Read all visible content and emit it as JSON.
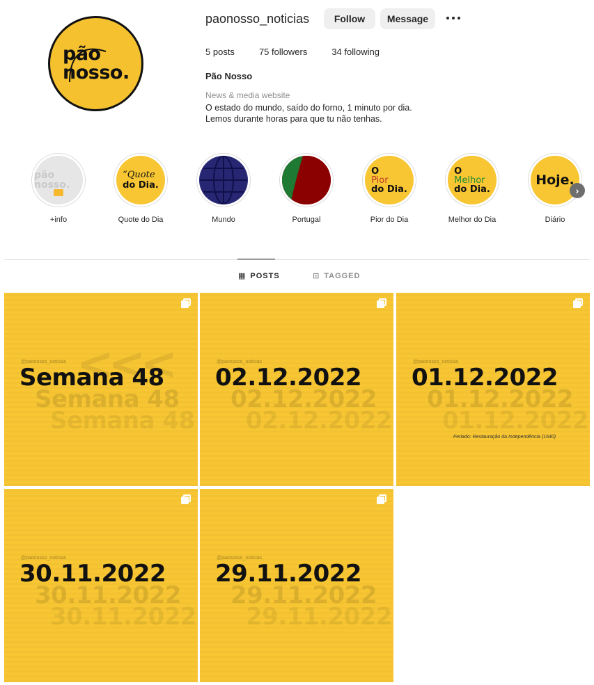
{
  "profile": {
    "username": "paonosso_noticias",
    "follow_label": "Follow",
    "message_label": "Message",
    "more_icon": "more-horizontal-icon",
    "avatar_text_line1": "pão",
    "avatar_text_line2": "nosso.",
    "posts": "5",
    "posts_label": "posts",
    "followers": "75",
    "followers_label": "followers",
    "following": "34",
    "following_label": "following",
    "full_name": "Pão Nosso",
    "category": "News & media website",
    "bio_line1": "O estado do mundo, saído do forno, 1 minuto por dia.",
    "bio_line2": "Lemos durante horas para que tu não tenhas."
  },
  "highlights": [
    {
      "label": "+info",
      "cover_text": "pão nosso.",
      "bg": "#e8e8e8"
    },
    {
      "label": "Quote do Dia",
      "cover_text_1": "“Quote",
      "cover_text_2": "do Dia.",
      "bg": "#f8c633"
    },
    {
      "label": "Mundo",
      "bg": "#2a2a7a"
    },
    {
      "label": "Portugal",
      "bg": "#8b0000",
      "accent": "#1e7a33"
    },
    {
      "label": "Pior do Dia",
      "cover_text_1": "O",
      "cover_text_2": "Pior",
      "cover_text_3": "do Dia.",
      "bg": "#f8c633",
      "accent": "#c0392b"
    },
    {
      "label": "Melhor do Dia",
      "cover_text_1": "O",
      "cover_text_2": "Melhor",
      "cover_text_3": "do Dia.",
      "bg": "#f8c633",
      "accent": "#1e8a2f"
    },
    {
      "label": "Diário",
      "cover_text_1": "Hoje.",
      "bg": "#f8c633"
    }
  ],
  "tabs": {
    "posts": "POSTS",
    "tagged": "TAGGED"
  },
  "posts": [
    {
      "handle": "@paonosso_noticias",
      "title": "Semana 48",
      "chevrons": "<<<",
      "note": ""
    },
    {
      "handle": "@paonosso_noticias",
      "title": "02.12.2022",
      "note": ""
    },
    {
      "handle": "@paonosso_noticias",
      "title": "01.12.2022",
      "note": "Feriado: Restauração da Independência (1640)"
    },
    {
      "handle": "@paonosso_noticias",
      "title": "30.11.2022",
      "note": ""
    },
    {
      "handle": "@paonosso_noticias",
      "title": "29.11.2022",
      "note": ""
    }
  ]
}
